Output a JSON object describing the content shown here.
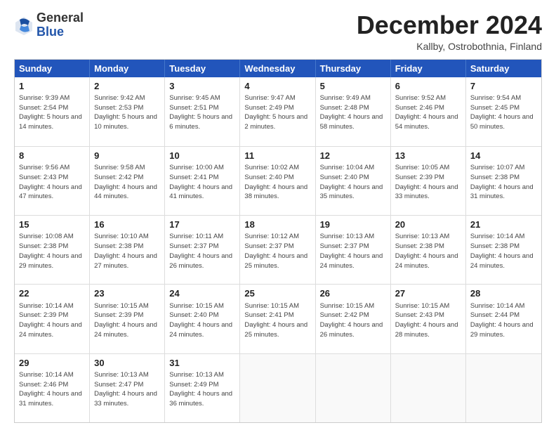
{
  "logo": {
    "general": "General",
    "blue": "Blue"
  },
  "header": {
    "month": "December 2024",
    "location": "Kallby, Ostrobothnia, Finland"
  },
  "days": [
    "Sunday",
    "Monday",
    "Tuesday",
    "Wednesday",
    "Thursday",
    "Friday",
    "Saturday"
  ],
  "weeks": [
    [
      {
        "day": "1",
        "sunrise": "Sunrise: 9:39 AM",
        "sunset": "Sunset: 2:54 PM",
        "daylight": "Daylight: 5 hours and 14 minutes."
      },
      {
        "day": "2",
        "sunrise": "Sunrise: 9:42 AM",
        "sunset": "Sunset: 2:53 PM",
        "daylight": "Daylight: 5 hours and 10 minutes."
      },
      {
        "day": "3",
        "sunrise": "Sunrise: 9:45 AM",
        "sunset": "Sunset: 2:51 PM",
        "daylight": "Daylight: 5 hours and 6 minutes."
      },
      {
        "day": "4",
        "sunrise": "Sunrise: 9:47 AM",
        "sunset": "Sunset: 2:49 PM",
        "daylight": "Daylight: 5 hours and 2 minutes."
      },
      {
        "day": "5",
        "sunrise": "Sunrise: 9:49 AM",
        "sunset": "Sunset: 2:48 PM",
        "daylight": "Daylight: 4 hours and 58 minutes."
      },
      {
        "day": "6",
        "sunrise": "Sunrise: 9:52 AM",
        "sunset": "Sunset: 2:46 PM",
        "daylight": "Daylight: 4 hours and 54 minutes."
      },
      {
        "day": "7",
        "sunrise": "Sunrise: 9:54 AM",
        "sunset": "Sunset: 2:45 PM",
        "daylight": "Daylight: 4 hours and 50 minutes."
      }
    ],
    [
      {
        "day": "8",
        "sunrise": "Sunrise: 9:56 AM",
        "sunset": "Sunset: 2:43 PM",
        "daylight": "Daylight: 4 hours and 47 minutes."
      },
      {
        "day": "9",
        "sunrise": "Sunrise: 9:58 AM",
        "sunset": "Sunset: 2:42 PM",
        "daylight": "Daylight: 4 hours and 44 minutes."
      },
      {
        "day": "10",
        "sunrise": "Sunrise: 10:00 AM",
        "sunset": "Sunset: 2:41 PM",
        "daylight": "Daylight: 4 hours and 41 minutes."
      },
      {
        "day": "11",
        "sunrise": "Sunrise: 10:02 AM",
        "sunset": "Sunset: 2:40 PM",
        "daylight": "Daylight: 4 hours and 38 minutes."
      },
      {
        "day": "12",
        "sunrise": "Sunrise: 10:04 AM",
        "sunset": "Sunset: 2:40 PM",
        "daylight": "Daylight: 4 hours and 35 minutes."
      },
      {
        "day": "13",
        "sunrise": "Sunrise: 10:05 AM",
        "sunset": "Sunset: 2:39 PM",
        "daylight": "Daylight: 4 hours and 33 minutes."
      },
      {
        "day": "14",
        "sunrise": "Sunrise: 10:07 AM",
        "sunset": "Sunset: 2:38 PM",
        "daylight": "Daylight: 4 hours and 31 minutes."
      }
    ],
    [
      {
        "day": "15",
        "sunrise": "Sunrise: 10:08 AM",
        "sunset": "Sunset: 2:38 PM",
        "daylight": "Daylight: 4 hours and 29 minutes."
      },
      {
        "day": "16",
        "sunrise": "Sunrise: 10:10 AM",
        "sunset": "Sunset: 2:38 PM",
        "daylight": "Daylight: 4 hours and 27 minutes."
      },
      {
        "day": "17",
        "sunrise": "Sunrise: 10:11 AM",
        "sunset": "Sunset: 2:37 PM",
        "daylight": "Daylight: 4 hours and 26 minutes."
      },
      {
        "day": "18",
        "sunrise": "Sunrise: 10:12 AM",
        "sunset": "Sunset: 2:37 PM",
        "daylight": "Daylight: 4 hours and 25 minutes."
      },
      {
        "day": "19",
        "sunrise": "Sunrise: 10:13 AM",
        "sunset": "Sunset: 2:37 PM",
        "daylight": "Daylight: 4 hours and 24 minutes."
      },
      {
        "day": "20",
        "sunrise": "Sunrise: 10:13 AM",
        "sunset": "Sunset: 2:38 PM",
        "daylight": "Daylight: 4 hours and 24 minutes."
      },
      {
        "day": "21",
        "sunrise": "Sunrise: 10:14 AM",
        "sunset": "Sunset: 2:38 PM",
        "daylight": "Daylight: 4 hours and 24 minutes."
      }
    ],
    [
      {
        "day": "22",
        "sunrise": "Sunrise: 10:14 AM",
        "sunset": "Sunset: 2:39 PM",
        "daylight": "Daylight: 4 hours and 24 minutes."
      },
      {
        "day": "23",
        "sunrise": "Sunrise: 10:15 AM",
        "sunset": "Sunset: 2:39 PM",
        "daylight": "Daylight: 4 hours and 24 minutes."
      },
      {
        "day": "24",
        "sunrise": "Sunrise: 10:15 AM",
        "sunset": "Sunset: 2:40 PM",
        "daylight": "Daylight: 4 hours and 24 minutes."
      },
      {
        "day": "25",
        "sunrise": "Sunrise: 10:15 AM",
        "sunset": "Sunset: 2:41 PM",
        "daylight": "Daylight: 4 hours and 25 minutes."
      },
      {
        "day": "26",
        "sunrise": "Sunrise: 10:15 AM",
        "sunset": "Sunset: 2:42 PM",
        "daylight": "Daylight: 4 hours and 26 minutes."
      },
      {
        "day": "27",
        "sunrise": "Sunrise: 10:15 AM",
        "sunset": "Sunset: 2:43 PM",
        "daylight": "Daylight: 4 hours and 28 minutes."
      },
      {
        "day": "28",
        "sunrise": "Sunrise: 10:14 AM",
        "sunset": "Sunset: 2:44 PM",
        "daylight": "Daylight: 4 hours and 29 minutes."
      }
    ],
    [
      {
        "day": "29",
        "sunrise": "Sunrise: 10:14 AM",
        "sunset": "Sunset: 2:46 PM",
        "daylight": "Daylight: 4 hours and 31 minutes."
      },
      {
        "day": "30",
        "sunrise": "Sunrise: 10:13 AM",
        "sunset": "Sunset: 2:47 PM",
        "daylight": "Daylight: 4 hours and 33 minutes."
      },
      {
        "day": "31",
        "sunrise": "Sunrise: 10:13 AM",
        "sunset": "Sunset: 2:49 PM",
        "daylight": "Daylight: 4 hours and 36 minutes."
      },
      null,
      null,
      null,
      null
    ]
  ]
}
